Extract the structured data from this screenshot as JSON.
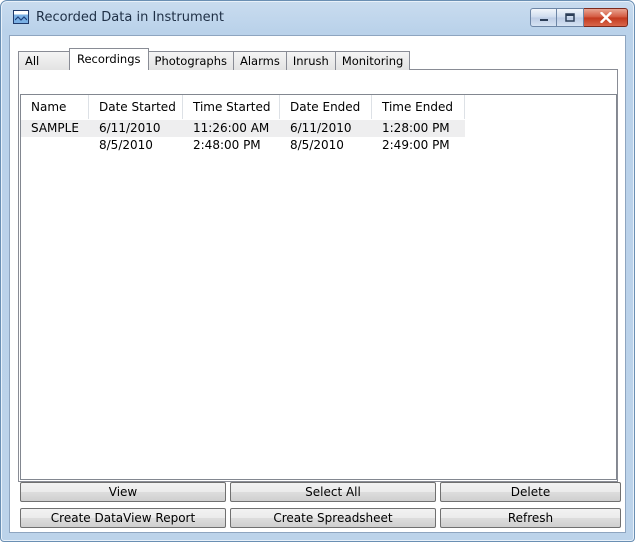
{
  "window": {
    "title": "Recorded Data in Instrument",
    "accent": "#bcd3ea",
    "close_color": "#c2381d"
  },
  "tabs": [
    {
      "label": "All"
    },
    {
      "label": "Recordings"
    },
    {
      "label": "Photographs"
    },
    {
      "label": "Alarms"
    },
    {
      "label": "Inrush"
    },
    {
      "label": "Monitoring"
    }
  ],
  "active_tab": "Recordings",
  "table": {
    "columns": [
      "Name",
      "Date Started",
      "Time Started",
      "Date Ended",
      "Time Ended"
    ],
    "rows": [
      {
        "name": "SAMPLE",
        "date_started": "6/11/2010",
        "time_started": "11:26:00 AM",
        "date_ended": "6/11/2010",
        "time_ended": "1:28:00 PM",
        "selected": true
      },
      {
        "name": "",
        "date_started": "8/5/2010",
        "time_started": "2:48:00 PM",
        "date_ended": "8/5/2010",
        "time_ended": "2:49:00 PM",
        "selected": false
      }
    ]
  },
  "buttons": {
    "view": "View",
    "select_all": "Select All",
    "delete": "Delete",
    "create_report": "Create DataView Report",
    "create_spreadsheet": "Create Spreadsheet",
    "refresh": "Refresh"
  },
  "icons": {
    "app": "app-chart-icon",
    "minimize": "minimize-icon",
    "maximize": "maximize-icon",
    "close": "close-icon"
  }
}
